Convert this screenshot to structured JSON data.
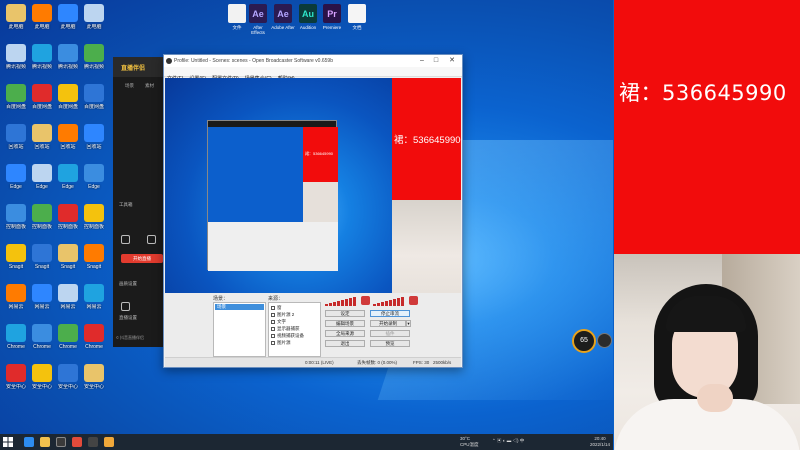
{
  "desktop": {
    "left_icons": [
      {
        "label": "此电脑",
        "color": "#e9c46a"
      },
      {
        "label": "腾讯视频",
        "color": "#ff7b00"
      },
      {
        "label": "百度网盘",
        "color": "#2e86ff"
      },
      {
        "label": "回收站",
        "color": "#bcd5f0"
      },
      {
        "label": "Edge",
        "color": "#1fa3e0"
      },
      {
        "label": "控制面板",
        "color": "#3b8de0"
      },
      {
        "label": "Snagit",
        "color": "#4cae4c"
      },
      {
        "label": "网易云",
        "color": "#e02b2b"
      },
      {
        "label": "Chrome",
        "color": "#f4c20d"
      },
      {
        "label": "安全中心",
        "color": "#2e75d6"
      }
    ],
    "top_apps": [
      {
        "glyph": "",
        "label": "文件",
        "bg": "#f2f2f2",
        "fg": "#333"
      },
      {
        "glyph": "Ae",
        "label": "After Effects",
        "bg": "#2b1b52",
        "fg": "#b4a6ff"
      },
      {
        "glyph": "Ae",
        "label": "Adobe After",
        "bg": "#2b1b52",
        "fg": "#b4a6ff"
      },
      {
        "glyph": "Au",
        "label": "Audition",
        "bg": "#0b3b3a",
        "fg": "#2ee6c9"
      },
      {
        "glyph": "Pr",
        "label": "Premiere",
        "bg": "#2a1348",
        "fg": "#d9a2ff"
      },
      {
        "glyph": "",
        "label": "文档",
        "bg": "#f5f5f5",
        "fg": "#333"
      }
    ],
    "badge_value": "65"
  },
  "assistant": {
    "brand": "直播伴侣",
    "tab1": "场景",
    "tab2": "素材",
    "row1": "工具箱",
    "row2": "画质设置",
    "row3": "直播设置",
    "start_label": "开始直播",
    "footer": "© 抖音直播伴侣"
  },
  "obs": {
    "title": "Profile: Untitled - Scenes: scenes - Open Broadcaster Software v0.659b",
    "menu": [
      "文件(F)",
      "设置(S)",
      "配置文件(P)",
      "场景集合(C)",
      "帮助(H)"
    ],
    "preview_text": "裙：536645990",
    "nested_text": "裙：536645990",
    "scenes_header": "场景：",
    "sources_header": "来源：",
    "scene_selected": "场景",
    "sources": [
      "窗",
      "图片源 2",
      "文字",
      "显示器捕获",
      "视频捕获设备",
      "图片源"
    ],
    "buttons": {
      "settings": "设定",
      "stop_stream": "停止串流",
      "edit_scene": "编辑场景",
      "start_recording": "开始录制",
      "global_sources": "全局来源",
      "plugins": "插件",
      "exit": "退出",
      "preview": "预览"
    },
    "status": {
      "time": "0:00:11 (LIVE)",
      "dropped": "丢失帧数: 0 (0.00%)",
      "fps": "FPS: 30",
      "bitrate": "2500kb/s"
    }
  },
  "taskbar": {
    "temp": "30°C",
    "cpu": "CPU温度",
    "time": "20:40",
    "date": "2022/1/14"
  },
  "overlay": {
    "promo_text": "裙：536645990"
  },
  "colors": {
    "promo_red": "#f20c0c",
    "obs_selection": "#3f8fdc",
    "desktop_blue": "#0a5fc6"
  }
}
